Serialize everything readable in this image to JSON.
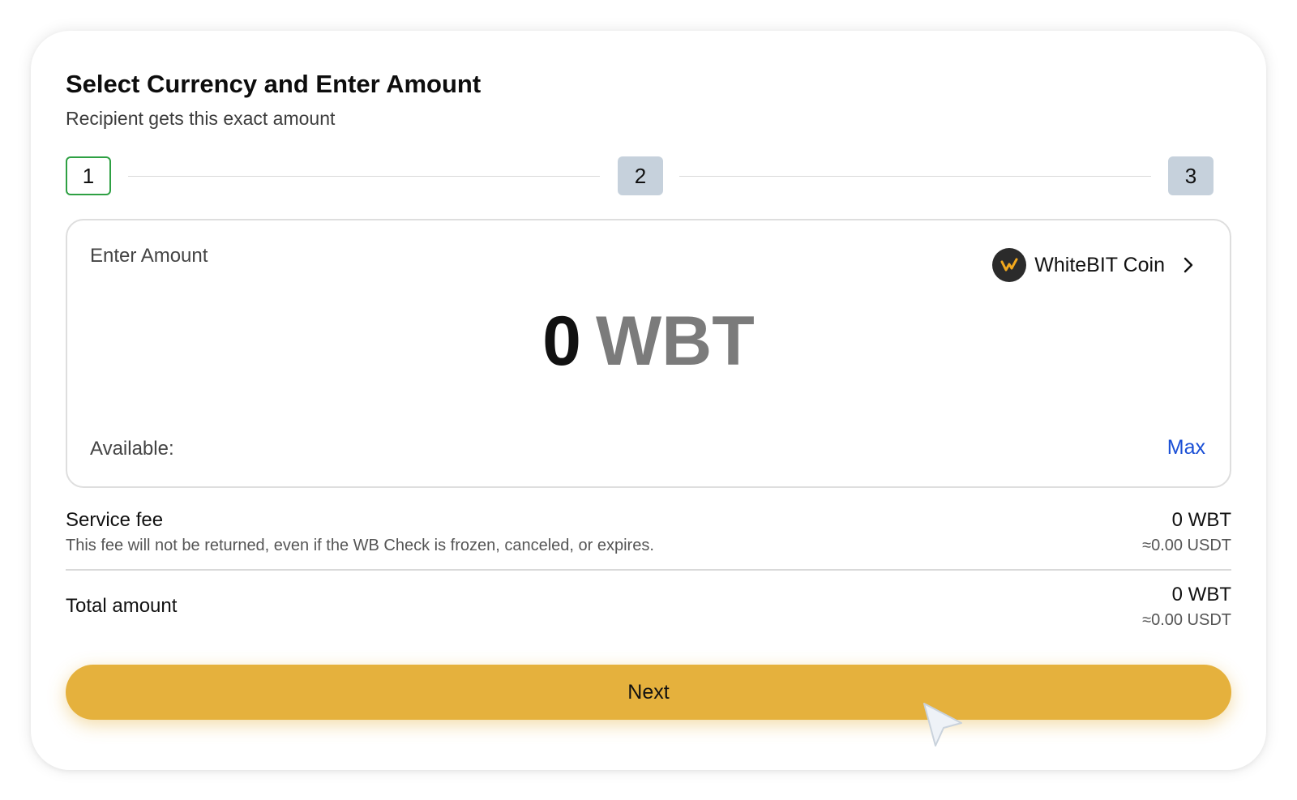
{
  "header": {
    "title": "Select Currency and Enter Amount",
    "subtitle": "Recipient gets this exact amount"
  },
  "steps": [
    {
      "label": "1",
      "state": "active"
    },
    {
      "label": "2",
      "state": "inactive"
    },
    {
      "label": "3",
      "state": "inactive"
    }
  ],
  "amount_box": {
    "enter_label": "Enter Amount",
    "currency": {
      "name": "WhiteBIT Coin",
      "icon": "whitebit-coin-icon"
    },
    "amount_value": "0",
    "amount_unit": "WBT",
    "available_label": "Available:",
    "max_label": "Max"
  },
  "service_fee": {
    "title": "Service fee",
    "note": "This fee will not be returned, even if the WB Check is frozen, canceled, or expires.",
    "value": "0 WBT",
    "usdt": "≈0.00 USDT"
  },
  "total": {
    "title": "Total amount",
    "value": "0 WBT",
    "usdt": "≈0.00 USDT"
  },
  "next_button": {
    "label": "Next"
  },
  "colors": {
    "accent": "#e5b13d",
    "step_active_border": "#2ea043",
    "step_inactive_bg": "#c6d1dc",
    "link": "#1a4fd6"
  }
}
